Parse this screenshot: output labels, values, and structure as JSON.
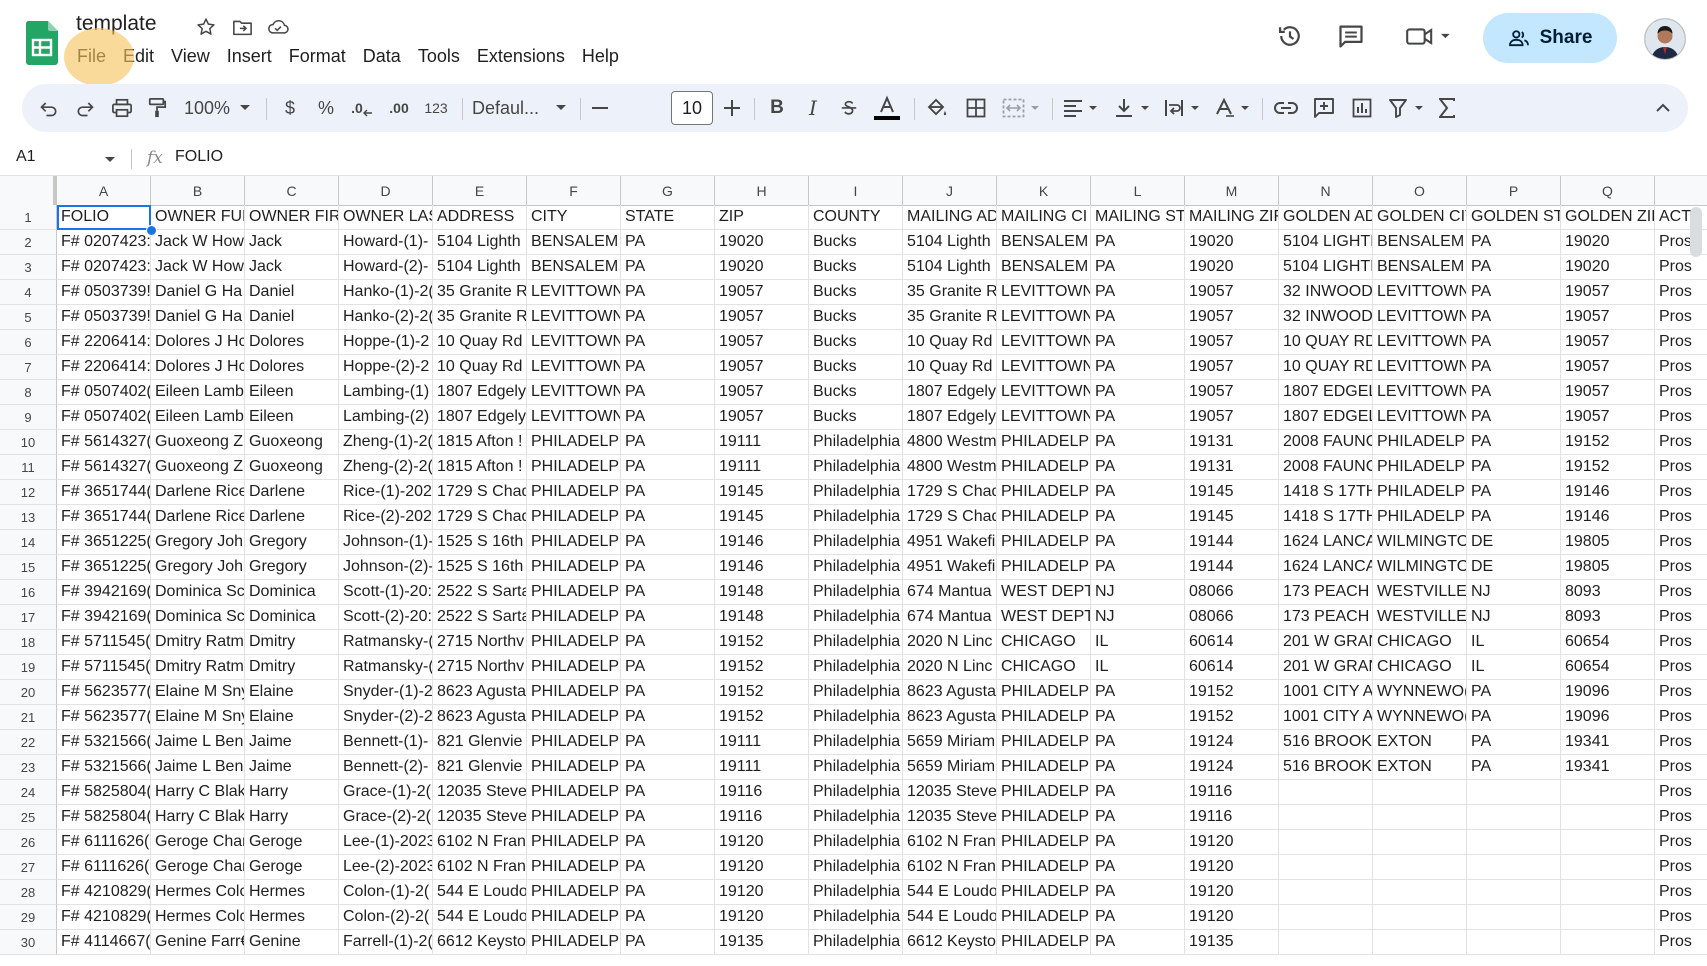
{
  "app": {
    "doc_title": "template",
    "menu": [
      "File",
      "Edit",
      "View",
      "Insert",
      "Format",
      "Data",
      "Tools",
      "Extensions",
      "Help"
    ],
    "share_label": "Share"
  },
  "toolbar": {
    "zoom": "100%",
    "currency": "$",
    "percent": "%",
    "dec_decrease": ".0",
    "dec_increase": ".00",
    "number_format": "123",
    "font": "Defaul...",
    "font_size": "10",
    "colors": {
      "accent": "#1a73e8",
      "share_bg": "#c2e7ff",
      "toolbar_bg": "#edf2fa",
      "sheets_green": "#188038"
    }
  },
  "formula_bar": {
    "cell_ref": "A1",
    "fx": "fx",
    "value": "FOLIO"
  },
  "columns": [
    "A",
    "B",
    "C",
    "D",
    "E",
    "F",
    "G",
    "H",
    "I",
    "J",
    "K",
    "L",
    "M",
    "N",
    "O",
    "P",
    "Q",
    ""
  ],
  "rows": [
    {
      "n": "1",
      "c": [
        "FOLIO",
        "OWNER FUL",
        "OWNER FIRS",
        "OWNER LAS",
        "ADDRESS",
        "CITY",
        "STATE",
        "ZIP",
        "COUNTY",
        "MAILING AD",
        "MAILING CI",
        "MAILING STA",
        "MAILING ZIF",
        "GOLDEN AD",
        "GOLDEN CIT",
        "GOLDEN STA",
        "GOLDEN ZIP",
        "ACTI"
      ]
    },
    {
      "n": "2",
      "c": [
        "F# 0207423:",
        "Jack W How",
        "Jack",
        "Howard-(1)-",
        "5104 Lighth",
        "BENSALEM",
        "PA",
        "19020",
        "Bucks",
        "5104 Lighth",
        "BENSALEM",
        "PA",
        "19020",
        "5104 LIGHTI",
        "BENSALEM",
        "PA",
        "19020",
        "Pros"
      ]
    },
    {
      "n": "3",
      "c": [
        "F# 0207423:",
        "Jack W How",
        "Jack",
        "Howard-(2)-",
        "5104 Lighth",
        "BENSALEM",
        "PA",
        "19020",
        "Bucks",
        "5104 Lighth",
        "BENSALEM",
        "PA",
        "19020",
        "5104 LIGHTI",
        "BENSALEM",
        "PA",
        "19020",
        "Pros"
      ]
    },
    {
      "n": "4",
      "c": [
        "F# 0503739!",
        "Daniel G Ha",
        "Daniel",
        "Hanko-(1)-2(",
        "35 Granite R",
        "LEVITTOWN",
        "PA",
        "19057",
        "Bucks",
        "35 Granite R",
        "LEVITTOWN",
        "PA",
        "19057",
        "32 INWOOD",
        "LEVITTOWN",
        "PA",
        "19057",
        "Pros"
      ]
    },
    {
      "n": "5",
      "c": [
        "F# 0503739!",
        "Daniel G Ha",
        "Daniel",
        "Hanko-(2)-2(",
        "35 Granite R",
        "LEVITTOWN",
        "PA",
        "19057",
        "Bucks",
        "35 Granite R",
        "LEVITTOWN",
        "PA",
        "19057",
        "32 INWOOD",
        "LEVITTOWN",
        "PA",
        "19057",
        "Pros"
      ]
    },
    {
      "n": "6",
      "c": [
        "F# 2206414:",
        "Dolores J Hc",
        "Dolores",
        "Hoppe-(1)-2",
        "10 Quay Rd",
        "LEVITTOWN",
        "PA",
        "19057",
        "Bucks",
        "10 Quay Rd",
        "LEVITTOWN",
        "PA",
        "19057",
        "10 QUAY RD",
        "LEVITTOWN",
        "PA",
        "19057",
        "Pros"
      ]
    },
    {
      "n": "7",
      "c": [
        "F# 2206414:",
        "Dolores J Hc",
        "Dolores",
        "Hoppe-(2)-2",
        "10 Quay Rd",
        "LEVITTOWN",
        "PA",
        "19057",
        "Bucks",
        "10 Quay Rd",
        "LEVITTOWN",
        "PA",
        "19057",
        "10 QUAY RD",
        "LEVITTOWN",
        "PA",
        "19057",
        "Pros"
      ]
    },
    {
      "n": "8",
      "c": [
        "F# 0507402(",
        "Eileen Lamb",
        "Eileen",
        "Lambing-(1)",
        "1807 Edgely",
        "LEVITTOWN",
        "PA",
        "19057",
        "Bucks",
        "1807 Edgely",
        "LEVITTOWN",
        "PA",
        "19057",
        "1807 EDGEL'",
        "LEVITTOWN",
        "PA",
        "19057",
        "Pros"
      ]
    },
    {
      "n": "9",
      "c": [
        "F# 0507402(",
        "Eileen Lamb",
        "Eileen",
        "Lambing-(2)",
        "1807 Edgely",
        "LEVITTOWN",
        "PA",
        "19057",
        "Bucks",
        "1807 Edgely",
        "LEVITTOWN",
        "PA",
        "19057",
        "1807 EDGEL'",
        "LEVITTOWN",
        "PA",
        "19057",
        "Pros"
      ]
    },
    {
      "n": "10",
      "c": [
        "F# 5614327(",
        "Guoxeong Zl",
        "Guoxeong",
        "Zheng-(1)-2(",
        "1815 Afton !",
        "PHILADELPH",
        "PA",
        "19111",
        "Philadelphia",
        "4800 Westm",
        "PHILADELPH",
        "PA",
        "19131",
        "2008 FAUNC",
        "PHILADELPH",
        "PA",
        "19152",
        "Pros"
      ]
    },
    {
      "n": "11",
      "c": [
        "F# 5614327(",
        "Guoxeong Zl",
        "Guoxeong",
        "Zheng-(2)-2(",
        "1815 Afton !",
        "PHILADELPH",
        "PA",
        "19111",
        "Philadelphia",
        "4800 Westm",
        "PHILADELPH",
        "PA",
        "19131",
        "2008 FAUNC",
        "PHILADELPH",
        "PA",
        "19152",
        "Pros"
      ]
    },
    {
      "n": "12",
      "c": [
        "F# 3651744(",
        "Darlene Rice",
        "Darlene",
        "Rice-(1)-202",
        "1729 S Chad",
        "PHILADELPH",
        "PA",
        "19145",
        "Philadelphia",
        "1729 S Chad",
        "PHILADELPH",
        "PA",
        "19145",
        "1418 S 17TH",
        "PHILADELPH",
        "PA",
        "19146",
        "Pros"
      ]
    },
    {
      "n": "13",
      "c": [
        "F# 3651744(",
        "Darlene Rice",
        "Darlene",
        "Rice-(2)-202",
        "1729 S Chad",
        "PHILADELPH",
        "PA",
        "19145",
        "Philadelphia",
        "1729 S Chad",
        "PHILADELPH",
        "PA",
        "19145",
        "1418 S 17TH",
        "PHILADELPH",
        "PA",
        "19146",
        "Pros"
      ]
    },
    {
      "n": "14",
      "c": [
        "F# 3651225(",
        "Gregory Joh",
        "Gregory",
        "Johnson-(1)-",
        "1525 S 16th",
        "PHILADELPH",
        "PA",
        "19146",
        "Philadelphia",
        "4951 Wakefi",
        "PHILADELPH",
        "PA",
        "19144",
        "1624 LANCA",
        "WILMINGTO",
        "DE",
        "19805",
        "Pros"
      ]
    },
    {
      "n": "15",
      "c": [
        "F# 3651225(",
        "Gregory Joh",
        "Gregory",
        "Johnson-(2)-",
        "1525 S 16th",
        "PHILADELPH",
        "PA",
        "19146",
        "Philadelphia",
        "4951 Wakefi",
        "PHILADELPH",
        "PA",
        "19144",
        "1624 LANCA",
        "WILMINGTO",
        "DE",
        "19805",
        "Pros"
      ]
    },
    {
      "n": "16",
      "c": [
        "F# 3942169(",
        "Dominica Sc",
        "Dominica",
        "Scott-(1)-20:",
        "2522 S Sarta",
        "PHILADELPH",
        "PA",
        "19148",
        "Philadelphia",
        "674 Mantua",
        "WEST DEPTF",
        "NJ",
        "08066",
        "173 PEACH !",
        "WESTVILLE",
        "NJ",
        "8093",
        "Pros"
      ]
    },
    {
      "n": "17",
      "c": [
        "F# 3942169(",
        "Dominica Sc",
        "Dominica",
        "Scott-(2)-20:",
        "2522 S Sarta",
        "PHILADELPH",
        "PA",
        "19148",
        "Philadelphia",
        "674 Mantua",
        "WEST DEPTF",
        "NJ",
        "08066",
        "173 PEACH !",
        "WESTVILLE",
        "NJ",
        "8093",
        "Pros"
      ]
    },
    {
      "n": "18",
      "c": [
        "F# 5711545(",
        "Dmitry Ratm",
        "Dmitry",
        "Ratmansky-(",
        "2715 Northv",
        "PHILADELPH",
        "PA",
        "19152",
        "Philadelphia",
        "2020 N Linc",
        "CHICAGO",
        "IL",
        "60614",
        "201 W GRAN",
        "CHICAGO",
        "IL",
        "60654",
        "Pros"
      ]
    },
    {
      "n": "19",
      "c": [
        "F# 5711545(",
        "Dmitry Ratm",
        "Dmitry",
        "Ratmansky-(",
        "2715 Northv",
        "PHILADELPH",
        "PA",
        "19152",
        "Philadelphia",
        "2020 N Linc",
        "CHICAGO",
        "IL",
        "60614",
        "201 W GRAN",
        "CHICAGO",
        "IL",
        "60654",
        "Pros"
      ]
    },
    {
      "n": "20",
      "c": [
        "F# 5623577(",
        "Elaine M Sny",
        "Elaine",
        "Snyder-(1)-2",
        "8623 Agusta",
        "PHILADELPH",
        "PA",
        "19152",
        "Philadelphia",
        "8623 Agusta",
        "PHILADELPH",
        "PA",
        "19152",
        "1001 CITY A'",
        "WYNNEWO(",
        "PA",
        "19096",
        "Pros"
      ]
    },
    {
      "n": "21",
      "c": [
        "F# 5623577(",
        "Elaine M Sny",
        "Elaine",
        "Snyder-(2)-2",
        "8623 Agusta",
        "PHILADELPH",
        "PA",
        "19152",
        "Philadelphia",
        "8623 Agusta",
        "PHILADELPH",
        "PA",
        "19152",
        "1001 CITY A'",
        "WYNNEWO(",
        "PA",
        "19096",
        "Pros"
      ]
    },
    {
      "n": "22",
      "c": [
        "F# 5321566(",
        "Jaime L Beni",
        "Jaime",
        "Bennett-(1)-",
        "821 Glenvie",
        "PHILADELPH",
        "PA",
        "19111",
        "Philadelphia",
        "5659 Miriam",
        "PHILADELPH",
        "PA",
        "19124",
        "516 BROOK\\",
        "EXTON",
        "PA",
        "19341",
        "Pros"
      ]
    },
    {
      "n": "23",
      "c": [
        "F# 5321566(",
        "Jaime L Beni",
        "Jaime",
        "Bennett-(2)-",
        "821 Glenvie",
        "PHILADELPH",
        "PA",
        "19111",
        "Philadelphia",
        "5659 Miriam",
        "PHILADELPH",
        "PA",
        "19124",
        "516 BROOK\\",
        "EXTON",
        "PA",
        "19341",
        "Pros"
      ]
    },
    {
      "n": "24",
      "c": [
        "F# 5825804(",
        "Harry C Blak",
        "Harry",
        "Grace-(1)-2(",
        "12035 Steve",
        "PHILADELPH",
        "PA",
        "19116",
        "Philadelphia",
        "12035 Steve",
        "PHILADELPH",
        "PA",
        "19116",
        "",
        "",
        "",
        "",
        "Pros"
      ]
    },
    {
      "n": "25",
      "c": [
        "F# 5825804(",
        "Harry C Blak",
        "Harry",
        "Grace-(2)-2(",
        "12035 Steve",
        "PHILADELPH",
        "PA",
        "19116",
        "Philadelphia",
        "12035 Steve",
        "PHILADELPH",
        "PA",
        "19116",
        "",
        "",
        "",
        "",
        "Pros"
      ]
    },
    {
      "n": "26",
      "c": [
        "F# 6111626(",
        "Geroge Char",
        "Geroge",
        "Lee-(1)-2023",
        "6102 N Fran",
        "PHILADELPH",
        "PA",
        "19120",
        "Philadelphia",
        "6102 N Fran",
        "PHILADELPH",
        "PA",
        "19120",
        "",
        "",
        "",
        "",
        "Pros"
      ]
    },
    {
      "n": "27",
      "c": [
        "F# 6111626(",
        "Geroge Char",
        "Geroge",
        "Lee-(2)-2023",
        "6102 N Fran",
        "PHILADELPH",
        "PA",
        "19120",
        "Philadelphia",
        "6102 N Fran",
        "PHILADELPH",
        "PA",
        "19120",
        "",
        "",
        "",
        "",
        "Pros"
      ]
    },
    {
      "n": "28",
      "c": [
        "F# 4210829(",
        "Hermes Colc",
        "Hermes",
        "Colon-(1)-2(",
        "544 E Loudo",
        "PHILADELPH",
        "PA",
        "19120",
        "Philadelphia",
        "544 E Loudo",
        "PHILADELPH",
        "PA",
        "19120",
        "",
        "",
        "",
        "",
        "Pros"
      ]
    },
    {
      "n": "29",
      "c": [
        "F# 4210829(",
        "Hermes Colc",
        "Hermes",
        "Colon-(2)-2(",
        "544 E Loudo",
        "PHILADELPH",
        "PA",
        "19120",
        "Philadelphia",
        "544 E Loudo",
        "PHILADELPH",
        "PA",
        "19120",
        "",
        "",
        "",
        "",
        "Pros"
      ]
    },
    {
      "n": "30",
      "c": [
        "F# 4114667(",
        "Genine Farr€",
        "Genine",
        "Farrell-(1)-2(",
        "6612 Keysto",
        "PHILADELPH",
        "PA",
        "19135",
        "Philadelphia",
        "6612 Keysto",
        "PHILADELPH",
        "PA",
        "19135",
        "",
        "",
        "",
        "",
        "Pros"
      ]
    }
  ]
}
